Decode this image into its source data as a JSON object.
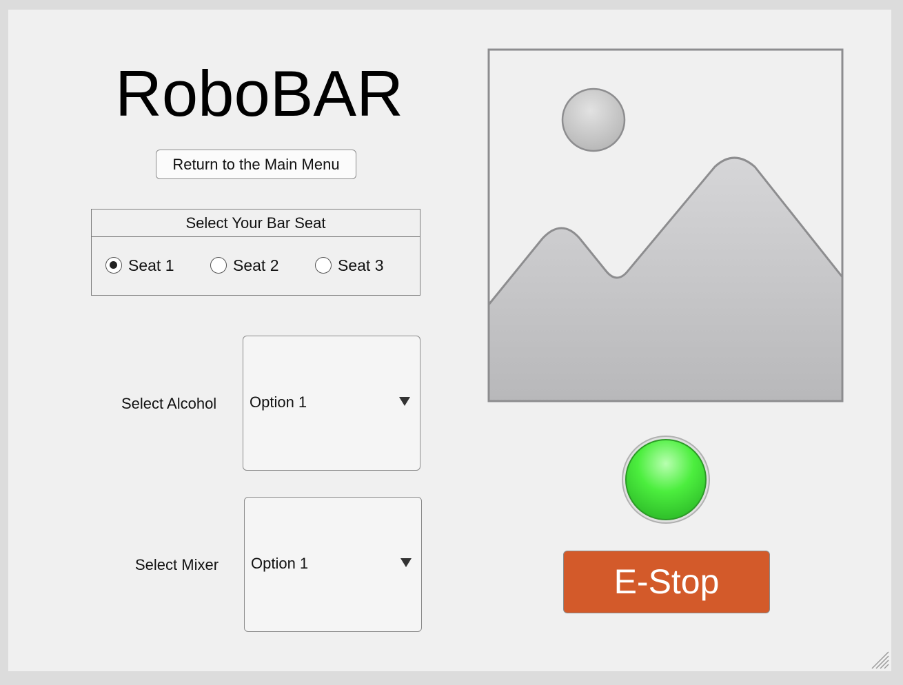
{
  "app": {
    "title": "RoboBAR"
  },
  "buttons": {
    "main_menu": "Return to the Main Menu",
    "estop": "E-Stop"
  },
  "seat_panel": {
    "title": "Select Your Bar Seat",
    "options": [
      {
        "label": "Seat 1",
        "selected": true
      },
      {
        "label": "Seat 2",
        "selected": false
      },
      {
        "label": "Seat 3",
        "selected": false
      }
    ]
  },
  "alcohol": {
    "label": "Select Alcohol",
    "value": "Option 1"
  },
  "mixer": {
    "label": "Select Mixer",
    "value": "Option 1"
  },
  "image": {
    "icon": "image-placeholder-icon"
  },
  "lamp": {
    "icon": "status-lamp",
    "color": "#44e03a",
    "state": "on"
  },
  "colors": {
    "estop": "#d35a2a",
    "background": "#f0f0f0"
  }
}
